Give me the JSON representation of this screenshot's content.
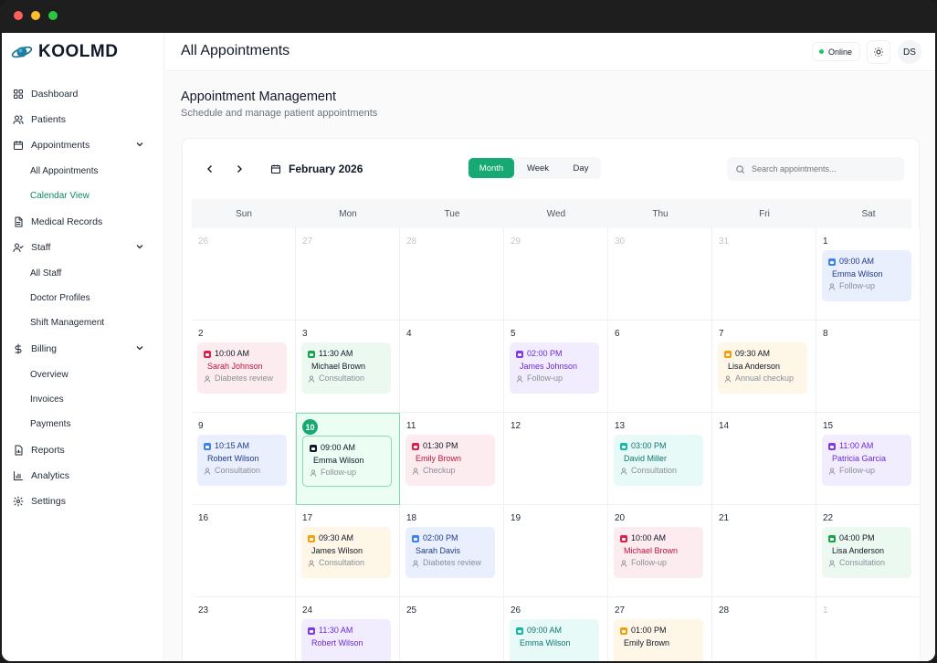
{
  "window": {
    "controls": [
      "close",
      "minimize",
      "maximize"
    ]
  },
  "brand": {
    "name": "KOOLMD",
    "icon": "planet-logo-icon"
  },
  "sidebar": {
    "items": [
      {
        "label": "Dashboard",
        "icon": "grid-icon"
      },
      {
        "label": "Patients",
        "icon": "users-icon"
      },
      {
        "label": "Appointments",
        "icon": "calendar-icon",
        "expanded": true,
        "children": [
          {
            "label": "All Appointments"
          },
          {
            "label": "Calendar View",
            "active": true
          }
        ]
      },
      {
        "label": "Medical Records",
        "icon": "file-icon"
      },
      {
        "label": "Staff",
        "icon": "user-check-icon",
        "expanded": true,
        "children": [
          {
            "label": "All Staff"
          },
          {
            "label": "Doctor Profiles"
          },
          {
            "label": "Shift Management"
          }
        ]
      },
      {
        "label": "Billing",
        "icon": "dollar-icon",
        "expanded": true,
        "children": [
          {
            "label": "Overview"
          },
          {
            "label": "Invoices"
          },
          {
            "label": "Payments"
          }
        ]
      },
      {
        "label": "Reports",
        "icon": "report-icon"
      },
      {
        "label": "Analytics",
        "icon": "bar-chart-icon"
      },
      {
        "label": "Settings",
        "icon": "gear-icon"
      }
    ]
  },
  "header": {
    "title": "All Appointments",
    "status": "Online",
    "theme_icon": "sun-icon",
    "avatar": "DS"
  },
  "page": {
    "title": "Appointment Management",
    "subtitle": "Schedule and manage patient appointments"
  },
  "calendar": {
    "month_label": "February 2026",
    "views": [
      {
        "label": "Month",
        "active": true
      },
      {
        "label": "Week"
      },
      {
        "label": "Day"
      }
    ],
    "search_placeholder": "Search appointments...",
    "weekdays": [
      "Sun",
      "Mon",
      "Tue",
      "Wed",
      "Thu",
      "Fri",
      "Sat"
    ],
    "colors": {
      "primary": "#16a974",
      "red": "#e11d48",
      "green": "#16a34a",
      "purple": "#7c3aed",
      "amber": "#f59e0b",
      "blue": "#3b82f6",
      "teal": "#14b8a6"
    },
    "days": [
      {
        "day": "26",
        "muted": true
      },
      {
        "day": "27",
        "muted": true
      },
      {
        "day": "28",
        "muted": true
      },
      {
        "day": "29",
        "muted": true
      },
      {
        "day": "30",
        "muted": true
      },
      {
        "day": "31",
        "muted": true
      },
      {
        "day": "1",
        "appt": {
          "time": "09:00 AM",
          "patient": "Emma Wilson",
          "type": "Follow-up",
          "color": "blue"
        }
      },
      {
        "day": "2",
        "appt": {
          "time": "10:00 AM",
          "patient": "Sarah Johnson",
          "type": "Diabetes review",
          "color": "red"
        }
      },
      {
        "day": "3",
        "appt": {
          "time": "11:30 AM",
          "patient": "Michael Brown",
          "type": "Consultation",
          "color": "green"
        }
      },
      {
        "day": "4"
      },
      {
        "day": "5",
        "appt": {
          "time": "02:00 PM",
          "patient": "James Johnson",
          "type": "Follow-up",
          "color": "purple"
        }
      },
      {
        "day": "6"
      },
      {
        "day": "7",
        "appt": {
          "time": "09:30 AM",
          "patient": "Lisa Anderson",
          "type": "Annual checkup",
          "color": "amber"
        }
      },
      {
        "day": "8"
      },
      {
        "day": "9",
        "appt": {
          "time": "10:15 AM",
          "patient": "Robert Wilson",
          "type": "Consultation",
          "color": "blue"
        }
      },
      {
        "day": "10",
        "today": true,
        "appt": {
          "time": "09:00 AM",
          "patient": "Emma Wilson",
          "type": "Follow-up",
          "color": "today-appt"
        }
      },
      {
        "day": "11",
        "appt": {
          "time": "01:30 PM",
          "patient": "Emily Brown",
          "type": "Checkup",
          "color": "red"
        }
      },
      {
        "day": "12"
      },
      {
        "day": "13",
        "appt": {
          "time": "03:00 PM",
          "patient": "David Miller",
          "type": "Consultation",
          "color": "teal"
        }
      },
      {
        "day": "14"
      },
      {
        "day": "15",
        "appt": {
          "time": "11:00 AM",
          "patient": "Patricia Garcia",
          "type": "Follow-up",
          "color": "purple"
        }
      },
      {
        "day": "16"
      },
      {
        "day": "17",
        "appt": {
          "time": "09:30 AM",
          "patient": "James Wilson",
          "type": "Consultation",
          "color": "amber"
        }
      },
      {
        "day": "18",
        "appt": {
          "time": "02:00 PM",
          "patient": "Sarah Davis",
          "type": "Diabetes review",
          "color": "blue"
        }
      },
      {
        "day": "19"
      },
      {
        "day": "20",
        "appt": {
          "time": "10:00 AM",
          "patient": "Michael Brown",
          "type": "Follow-up",
          "color": "red"
        }
      },
      {
        "day": "21"
      },
      {
        "day": "22",
        "appt": {
          "time": "04:00 PM",
          "patient": "Lisa Anderson",
          "type": "Consultation",
          "color": "green"
        }
      },
      {
        "day": "23"
      },
      {
        "day": "24",
        "appt": {
          "time": "11:30 AM",
          "patient": "Robert Wilson",
          "type": "",
          "color": "purple"
        }
      },
      {
        "day": "25"
      },
      {
        "day": "26",
        "appt": {
          "time": "09:00 AM",
          "patient": "Emma Wilson",
          "type": "",
          "color": "teal"
        }
      },
      {
        "day": "27",
        "appt": {
          "time": "01:00 PM",
          "patient": "Emily Brown",
          "type": "",
          "color": "amber"
        }
      },
      {
        "day": "28"
      },
      {
        "day": "1",
        "muted": true
      }
    ]
  }
}
